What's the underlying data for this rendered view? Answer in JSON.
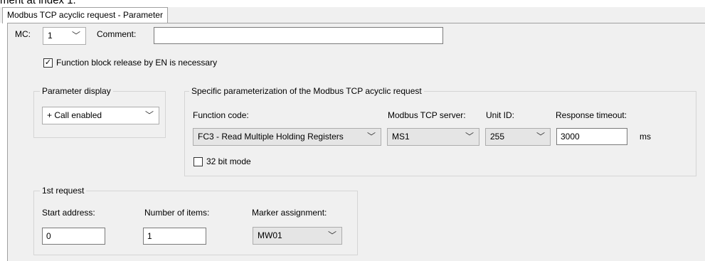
{
  "cut_text": "ment at index 1.",
  "tab": {
    "label": "Modbus TCP acyclic request - Parameter"
  },
  "mc": {
    "label": "MC:",
    "value": "1",
    "comment_label": "Comment:",
    "comment_value": ""
  },
  "en_checkbox": {
    "label": "Function block release by EN is necessary",
    "checked": true,
    "mark": "✓"
  },
  "parameter_display": {
    "title": "Parameter display",
    "value": "+ Call enabled"
  },
  "specific": {
    "title": "Specific parameterization of the Modbus TCP acyclic request",
    "function_code_label": "Function code:",
    "function_code_value": "FC3 - Read Multiple Holding Registers",
    "server_label": "Modbus TCP server:",
    "server_value": "MS1",
    "unit_label": "Unit ID:",
    "unit_value": "255",
    "timeout_label": "Response timeout:",
    "timeout_value": "3000",
    "timeout_unit": "ms",
    "bit32_label": "32 bit mode",
    "bit32_checked": false
  },
  "request": {
    "title": "1st request",
    "start_label": "Start address:",
    "start_value": "0",
    "items_label": "Number of items:",
    "items_value": "1",
    "marker_label": "Marker assignment:",
    "marker_value": "MW01"
  },
  "icons": {
    "dropdown": "chevron-down-icon",
    "check": "check-icon"
  }
}
